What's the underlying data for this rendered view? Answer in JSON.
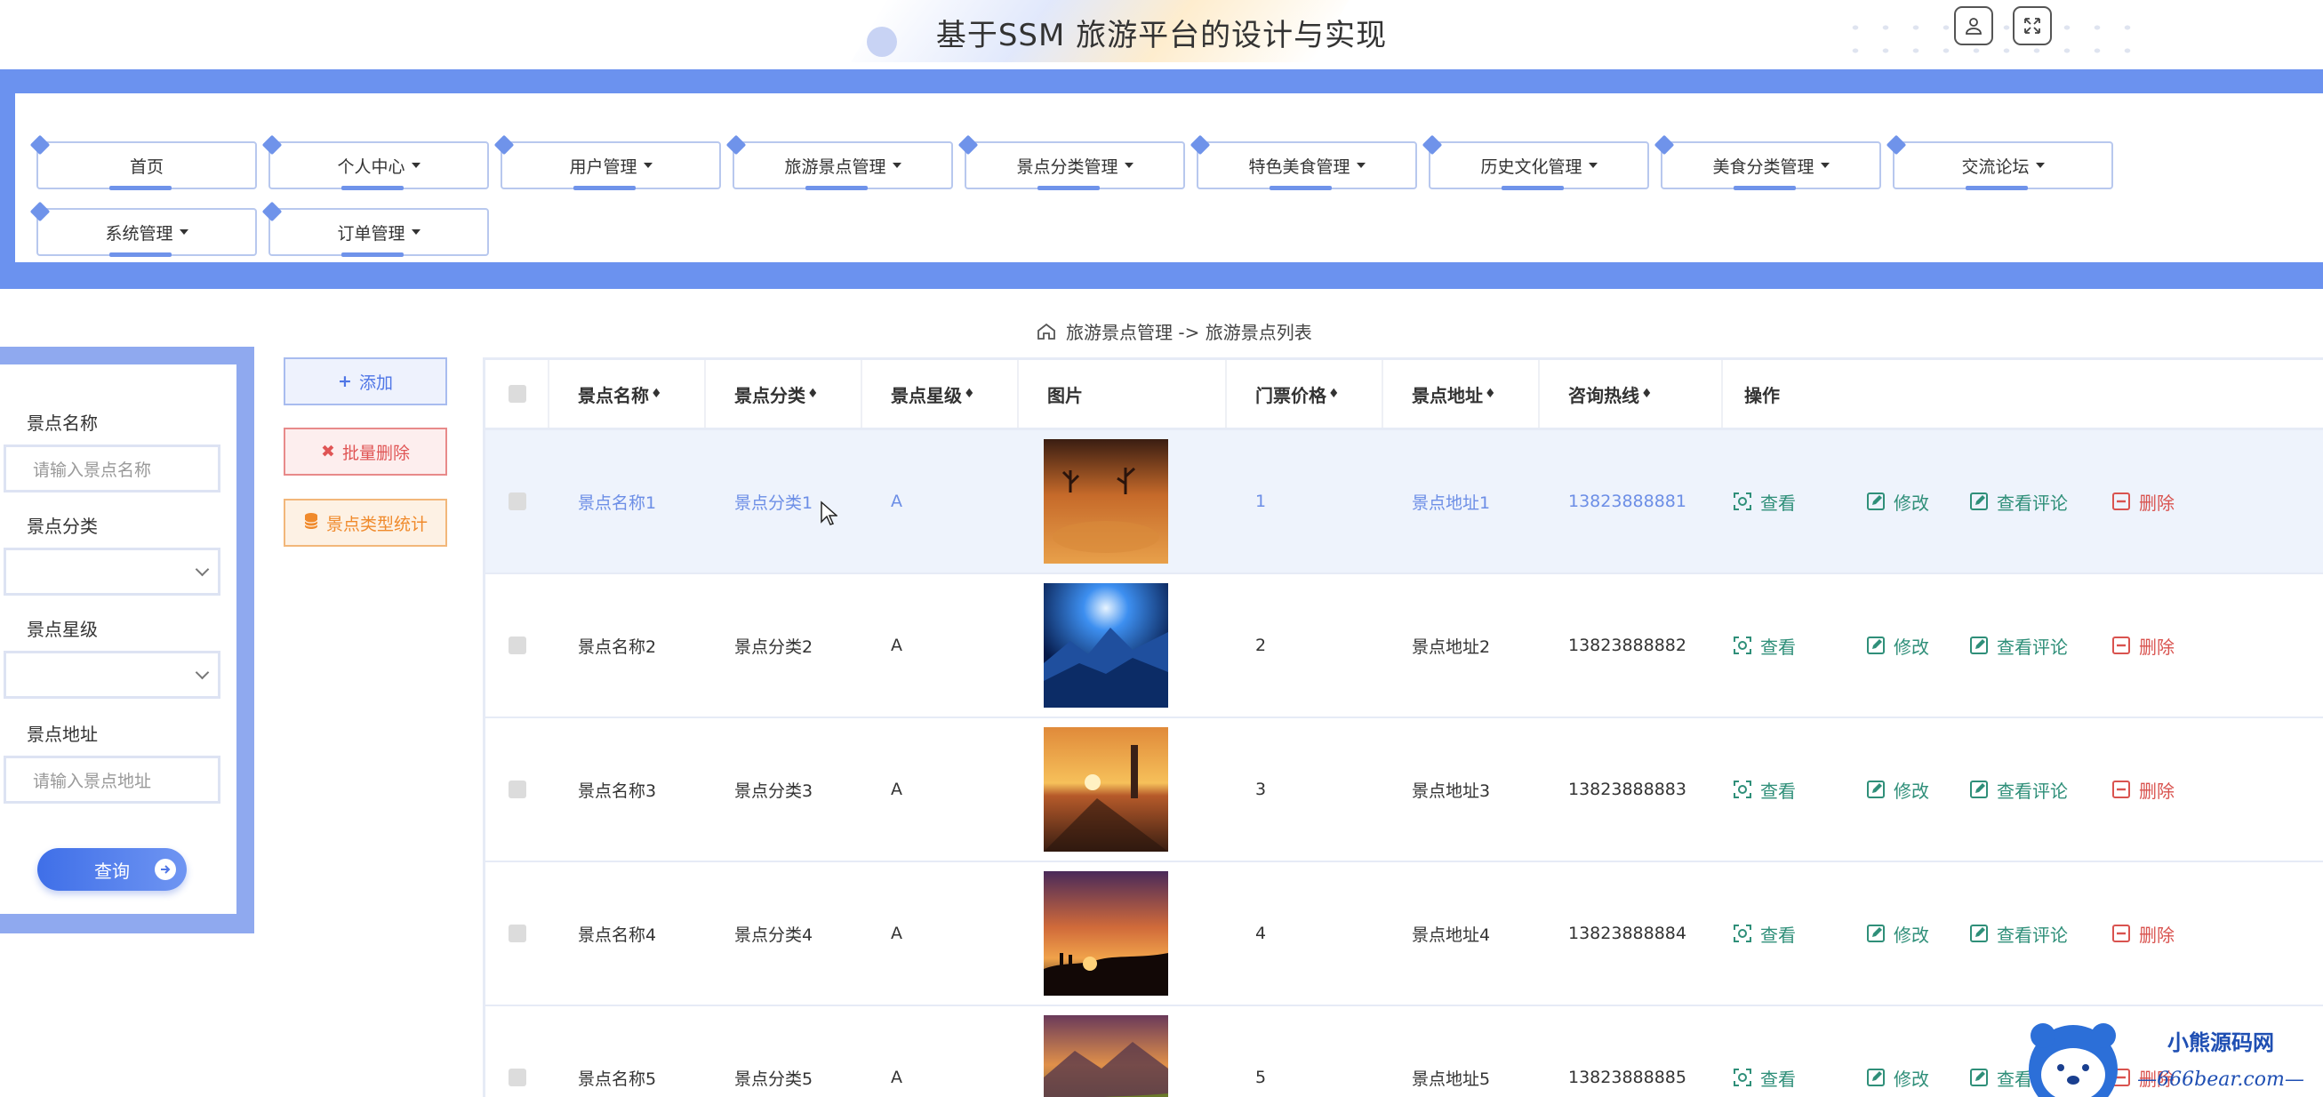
{
  "header": {
    "title": "基于SSM 旅游平台的设计与实现"
  },
  "nav": {
    "items": [
      {
        "label": "首页",
        "dropdown": false
      },
      {
        "label": "个人中心",
        "dropdown": true
      },
      {
        "label": "用户管理",
        "dropdown": true
      },
      {
        "label": "旅游景点管理",
        "dropdown": true
      },
      {
        "label": "景点分类管理",
        "dropdown": true
      },
      {
        "label": "特色美食管理",
        "dropdown": true
      },
      {
        "label": "历史文化管理",
        "dropdown": true
      },
      {
        "label": "美食分类管理",
        "dropdown": true
      },
      {
        "label": "交流论坛",
        "dropdown": true
      },
      {
        "label": "系统管理",
        "dropdown": true
      },
      {
        "label": "订单管理",
        "dropdown": true
      }
    ]
  },
  "breadcrumb": {
    "text": "旅游景点管理 -> 旅游景点列表"
  },
  "search": {
    "name_label": "景点名称",
    "name_placeholder": "请输入景点名称",
    "category_label": "景点分类",
    "category_value": "",
    "level_label": "景点星级",
    "level_value": "",
    "address_label": "景点地址",
    "address_placeholder": "请输入景点地址",
    "query_button": "查询"
  },
  "actions": {
    "add": "添加",
    "batch_delete": "批量删除",
    "stats": "景点类型统计"
  },
  "table": {
    "columns": [
      "景点名称",
      "景点分类",
      "景点星级",
      "图片",
      "门票价格",
      "景点地址",
      "咨询热线",
      "操作"
    ],
    "op_labels": {
      "view": "查看",
      "edit": "修改",
      "comments": "查看评论",
      "delete": "删除"
    },
    "rows": [
      {
        "name": "景点名称1",
        "category": "景点分类1",
        "level": "A",
        "price": "1",
        "address": "景点地址1",
        "phone": "13823888881",
        "image": "desert-dead-trees",
        "highlight": true
      },
      {
        "name": "景点名称2",
        "category": "景点分类2",
        "level": "A",
        "price": "2",
        "address": "景点地址2",
        "phone": "13823888882",
        "image": "blue-mountain-glow",
        "highlight": false
      },
      {
        "name": "景点名称3",
        "category": "景点分类3",
        "level": "A",
        "price": "3",
        "address": "景点地址3",
        "phone": "13823888883",
        "image": "sunset-pier",
        "highlight": false
      },
      {
        "name": "景点名称4",
        "category": "景点分类4",
        "level": "A",
        "price": "4",
        "address": "景点地址4",
        "phone": "13823888884",
        "image": "sunset-silhouette",
        "highlight": false
      },
      {
        "name": "景点名称5",
        "category": "景点分类5",
        "level": "A",
        "price": "5",
        "address": "景点地址5",
        "phone": "13823888885",
        "image": "mountain-meadow-dusk",
        "highlight": false
      }
    ]
  },
  "watermark": {
    "name": "小熊源码网",
    "url": "—666bear.com—"
  },
  "colors": {
    "accent": "#6b92ef",
    "link_green": "#2f8f79",
    "danger": "#d9534f",
    "warning": "#f08a2c"
  }
}
